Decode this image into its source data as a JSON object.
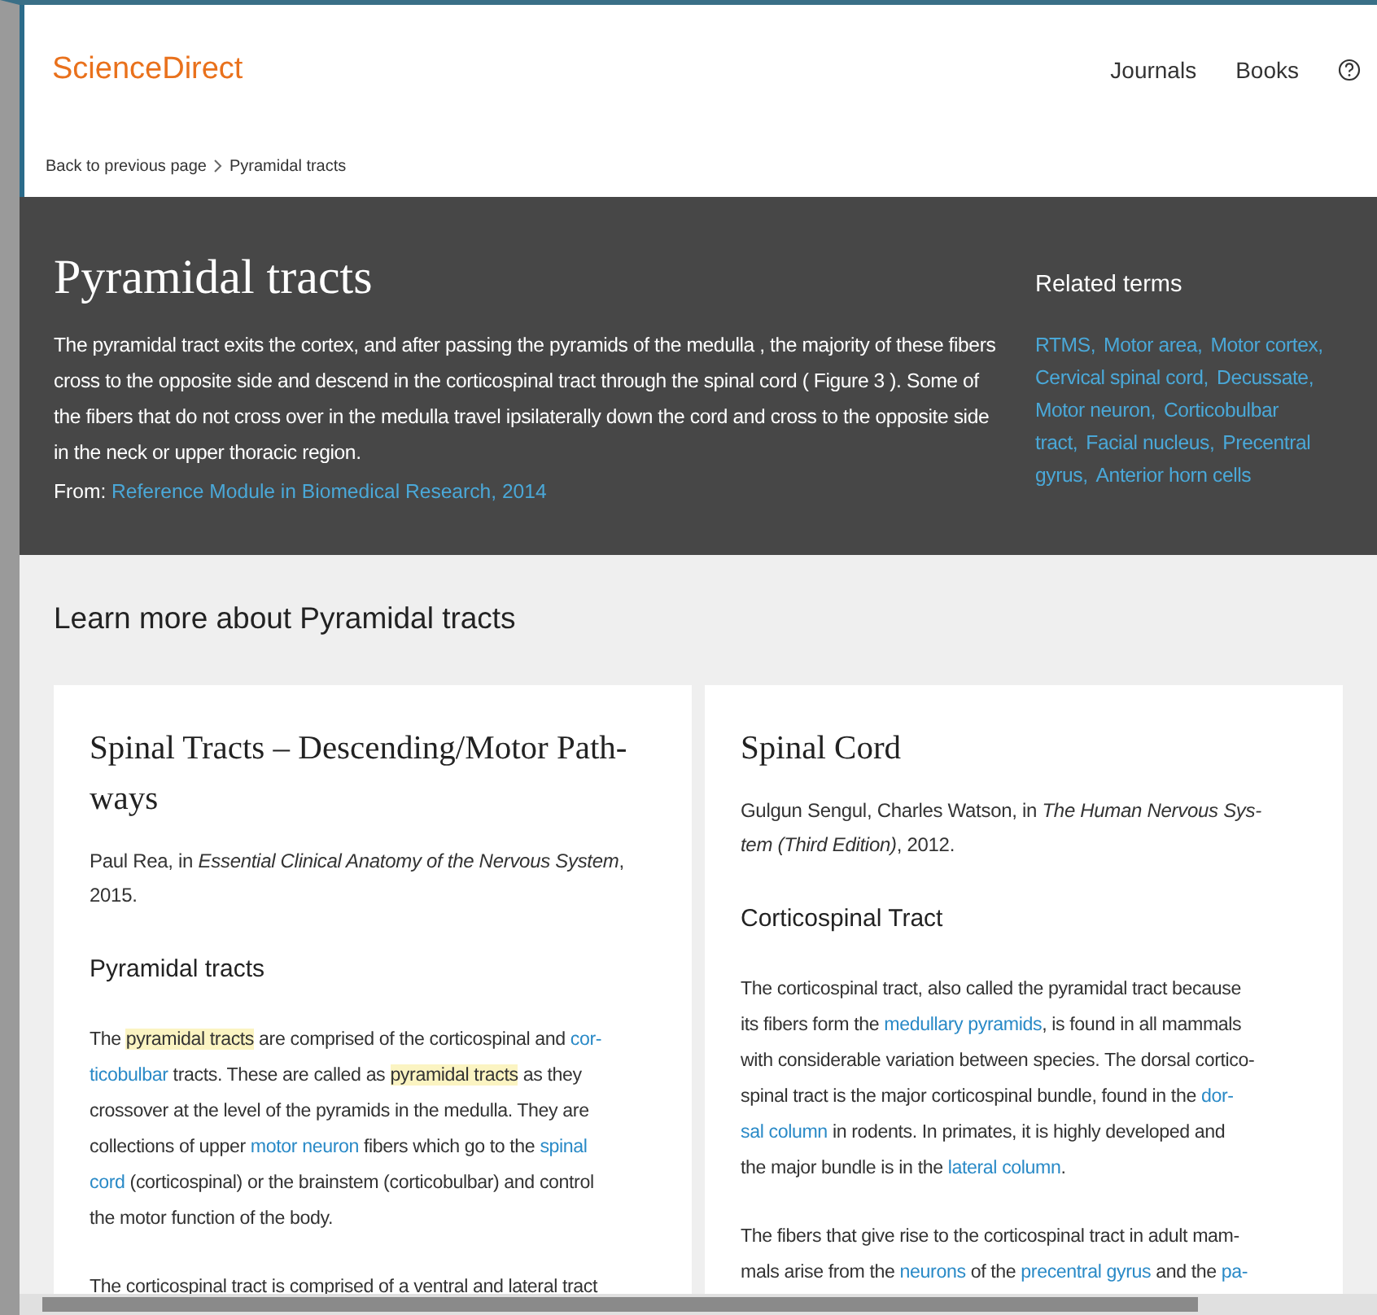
{
  "header": {
    "logo": "ScienceDirect",
    "nav": [
      {
        "label": "Journals"
      },
      {
        "label": "Books"
      }
    ]
  },
  "breadcrumb": {
    "back": "Back to previous page",
    "current": "Pyramidal tracts"
  },
  "topic": {
    "title": "Pyramidal tracts",
    "definition": "The pyramidal tract exits the cortex, and after passing the pyramids of the medulla , the majority of these fibers cross to the opposite side and descend in the corticospinal tract through the spinal cord ( Figure 3 ). Some of the fibers that do not cross over in the medulla travel ipsilaterally down the cord and cross to the opposite side in the neck or upper thoracic region.",
    "source_label": "From:",
    "source_link": "Reference Module in Biomedical Research, 2014",
    "related_heading": "Related terms",
    "related_lines": [
      [
        "RTMS,",
        "Motor area,",
        "Motor cortex,"
      ],
      [
        "Cervical spinal cord,",
        "Decussate,"
      ],
      [
        "Motor neuron,",
        "Corticobulbar"
      ],
      [
        "tract,",
        "Facial nucleus,",
        "Precentral"
      ],
      [
        "gyrus,",
        "Anterior horn cells"
      ]
    ]
  },
  "learn_more": {
    "heading": "Learn more about Pyramidal tracts",
    "cards": [
      {
        "title_lines": [
          "Spinal Tracts – Descending/Motor Path-",
          "ways"
        ],
        "citation_lines": [
          "Paul Rea, in *Essential Clinical Anatomy of the Nervous System*,",
          "2015."
        ],
        "section": "Pyramidal tracts",
        "paragraphs": [
          [
            [
              {
                "kind": "text",
                "text": "The "
              },
              {
                "kind": "highlight",
                "text": "pyramidal tracts"
              },
              {
                "kind": "text",
                "text": " are comprised of the corticospinal and "
              },
              {
                "kind": "link",
                "text": "cor-"
              }
            ],
            [
              {
                "kind": "link",
                "text": "ticobulbar"
              },
              {
                "kind": "text",
                "text": " tracts. These are called as "
              },
              {
                "kind": "highlight",
                "text": "pyramidal tracts"
              },
              {
                "kind": "text",
                "text": " as they"
              }
            ],
            [
              {
                "kind": "text",
                "text": "crossover at the level of the pyramids in the medulla. They are"
              }
            ],
            [
              {
                "kind": "text",
                "text": "collections of upper "
              },
              {
                "kind": "link",
                "text": "motor neuron"
              },
              {
                "kind": "text",
                "text": " fibers which go to the "
              },
              {
                "kind": "link",
                "text": "spinal"
              }
            ],
            [
              {
                "kind": "link",
                "text": "cord"
              },
              {
                "kind": "text",
                "text": " (corticospinal) or the brainstem (corticobulbar) and control"
              }
            ],
            [
              {
                "kind": "text",
                "text": "the motor function of the body."
              }
            ]
          ],
          [
            [
              {
                "kind": "text",
                "text": "The corticospinal tract is comprised of a ventral and lateral tract"
              }
            ]
          ]
        ]
      },
      {
        "title_lines": [
          "Spinal Cord"
        ],
        "citation_lines": [
          "Gulgun Sengul, Charles Watson, in *The Human Nervous Sys-*",
          "*tem (Third Edition)*, 2012."
        ],
        "section": "Corticospinal Tract",
        "paragraphs": [
          [
            [
              {
                "kind": "text",
                "text": "The corticospinal tract, also called the pyramidal tract because"
              }
            ],
            [
              {
                "kind": "text",
                "text": "its fibers form the "
              },
              {
                "kind": "link",
                "text": "medullary pyramids"
              },
              {
                "kind": "text",
                "text": ", is found in all mammals"
              }
            ],
            [
              {
                "kind": "text",
                "text": "with considerable variation between species. The dorsal cortico-"
              }
            ],
            [
              {
                "kind": "text",
                "text": "spinal tract is the major corticospinal bundle, found in the "
              },
              {
                "kind": "link",
                "text": "dor-"
              }
            ],
            [
              {
                "kind": "link",
                "text": "sal column"
              },
              {
                "kind": "text",
                "text": " in rodents. In primates, it is highly developed and"
              }
            ],
            [
              {
                "kind": "text",
                "text": "the major bundle is in the "
              },
              {
                "kind": "link",
                "text": "lateral column"
              },
              {
                "kind": "text",
                "text": "."
              }
            ]
          ],
          [
            [
              {
                "kind": "text",
                "text": "The fibers that give rise to the corticospinal tract in adult mam-"
              }
            ],
            [
              {
                "kind": "text",
                "text": "mals arise from the "
              },
              {
                "kind": "link",
                "text": "neurons"
              },
              {
                "kind": "text",
                "text": " of the "
              },
              {
                "kind": "link",
                "text": "precentral gyrus"
              },
              {
                "kind": "text",
                "text": " and the "
              },
              {
                "kind": "link",
                "text": "pa-"
              }
            ]
          ]
        ]
      }
    ]
  }
}
